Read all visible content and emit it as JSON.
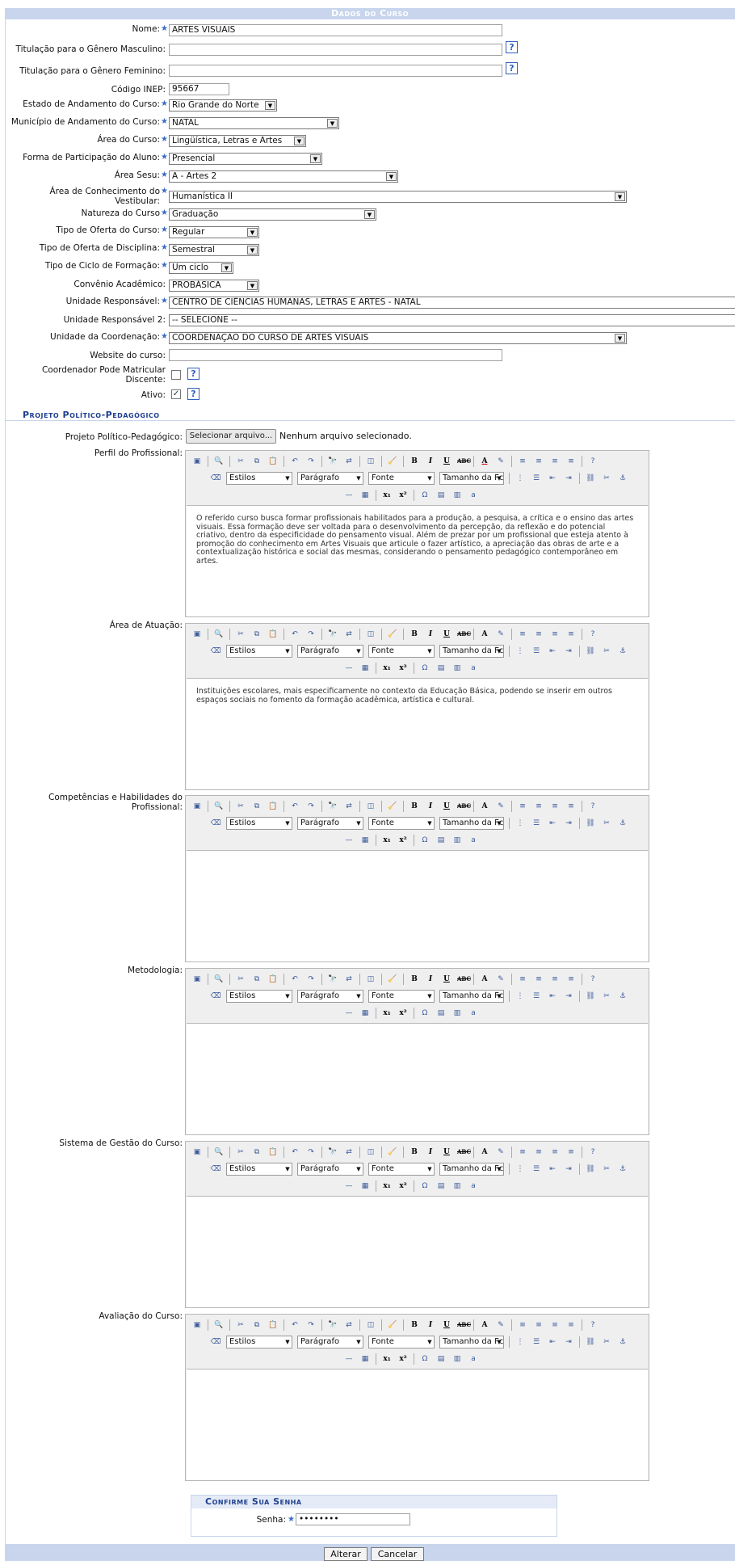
{
  "section_title": "Dados do Curso",
  "fields": {
    "nome": {
      "label": "Nome:",
      "value": "ARTES VISUAIS"
    },
    "tit_masc": {
      "label": "Titulação para o Gênero Masculino:",
      "value": ""
    },
    "tit_fem": {
      "label": "Titulação para o Gênero Feminino:",
      "value": ""
    },
    "codigo_inep": {
      "label": "Código INEP:",
      "value": "95667"
    },
    "estado": {
      "label": "Estado de Andamento do Curso:",
      "value": "Rio Grande do Norte"
    },
    "municipio": {
      "label": "Município de Andamento do Curso:",
      "value": "NATAL"
    },
    "area": {
      "label": "Área do Curso:",
      "value": "Lingüística, Letras e Artes"
    },
    "forma": {
      "label": "Forma de Participação do Aluno:",
      "value": "Presencial"
    },
    "area_sesu": {
      "label": "Área Sesu:",
      "value": "A - Artes 2"
    },
    "area_vest_l1": "Área de Conhecimento do",
    "area_vest_l2": "Vestibular:",
    "area_vest_value": "Humanística II",
    "natureza": {
      "label": "Natureza do Curso",
      "value": "Graduação"
    },
    "tipo_oferta_curso": {
      "label": "Tipo de Oferta do Curso:",
      "value": "Regular"
    },
    "tipo_oferta_disc": {
      "label": "Tipo de Oferta de Disciplina:",
      "value": "Semestral"
    },
    "tipo_ciclo": {
      "label": "Tipo de Ciclo de Formação:",
      "value": "Um ciclo"
    },
    "convenio": {
      "label": "Convênio Acadêmico:",
      "value": "PROBÁSICA"
    },
    "unidade": {
      "label": "Unidade Responsável:",
      "value": "CENTRO DE CIÊNCIAS HUMANAS, LETRAS E ARTES - NATAL"
    },
    "unidade2": {
      "label": "Unidade Responsável 2:",
      "value": "-- SELECIONE --"
    },
    "unidade_coord": {
      "label": "Unidade da Coordenação:",
      "value": "COORDENAÇÃO DO CURSO DE ARTES VISUAIS"
    },
    "website": {
      "label": "Website do curso:",
      "value": ""
    },
    "coord_l1": "Coordenador Pode Matricular",
    "coord_l2": "Discente:",
    "ativo": {
      "label": "Ativo:",
      "checked": "✓"
    }
  },
  "project_section": "Projeto Político-Pedagógico",
  "file": {
    "label": "Projeto Político-Pedagógico:",
    "button": "Selecionar arquivo...",
    "status": "Nenhum arquivo selecionado."
  },
  "toolbar": {
    "styles": "Estilos",
    "format": "Parágrafo",
    "font": "Fonte",
    "size": "Tamanho da Fc"
  },
  "editors": {
    "perfil": {
      "label": "Perfil do Profissional:",
      "content": "O referido curso busca formar profissionais habilitados para a produção, a pesquisa, a crítica e o ensino das artes visuais. Essa formação deve ser voltada para o desenvolvimento da percepção, da reflexão e do potencial criativo, dentro da especificidade do pensamento visual. Além de prezar por um profissional que esteja atento à promoção do conhecimento em Artes Visuais que articule o fazer artístico, a apreciação das obras de arte e a contextualização histórica e social das mesmas, considerando o pensamento pedagógico contemporâneo em artes."
    },
    "atuacao": {
      "label": "Área de Atuação:",
      "content": "Instituições escolares, mais especificamente no contexto da Educação Básica, podendo se inserir em outros espaços sociais no fomento da formação acadêmica, artística e cultural."
    },
    "competencias_l1": "Competências e Habilidades do",
    "competencias_l2": "Profissional:",
    "metodologia": {
      "label": "Metodologia:"
    },
    "gestao": {
      "label": "Sistema de Gestão do Curso:"
    },
    "avaliacao": {
      "label": "Avaliação do Curso:"
    }
  },
  "confirm": {
    "title": "Confirme Sua Senha",
    "label": "Senha:",
    "value": "••••••••"
  },
  "buttons": {
    "alterar": "Alterar",
    "cancelar": "Cancelar"
  },
  "colors": {
    "header": "#c8d5ec",
    "accent": "#1f3f8f",
    "star": "#3a6bc7"
  }
}
